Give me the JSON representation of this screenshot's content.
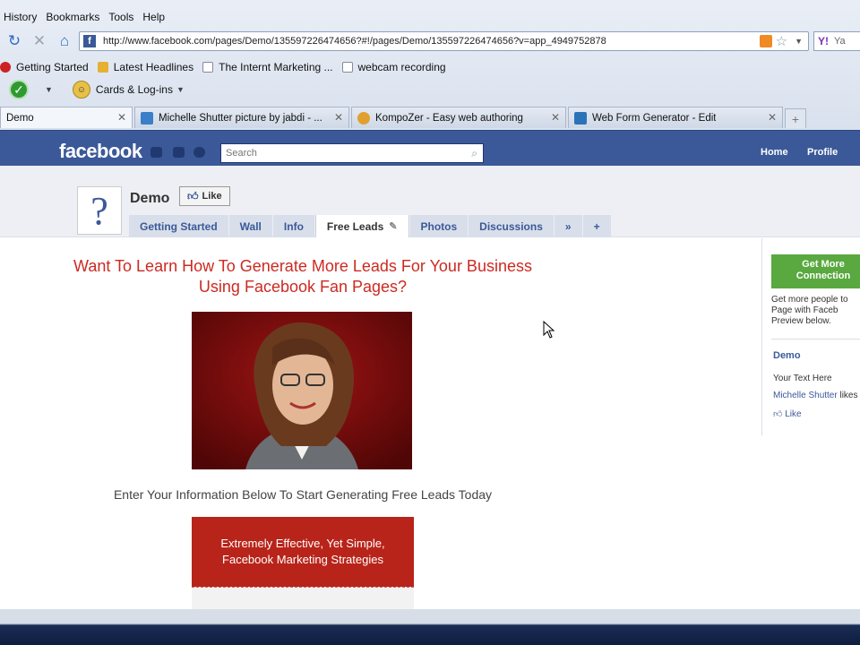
{
  "browser": {
    "menu": [
      "History",
      "Bookmarks",
      "Tools",
      "Help"
    ],
    "url": "http://www.facebook.com/pages/Demo/135597226474656?#!/pages/Demo/135597226474656?v=app_4949752878",
    "search_engine_label": "Ya",
    "bookmarks": [
      "Getting Started",
      "Latest Headlines",
      "The Internt Marketing ...",
      "webcam recording"
    ],
    "toolbar2_label": "Cards & Log-ins",
    "tabs": [
      {
        "label": "Demo",
        "active": true
      },
      {
        "label": "Michelle Shutter picture by jabdi - ...",
        "active": false
      },
      {
        "label": "KompoZer - Easy web authoring",
        "active": false
      },
      {
        "label": "Web Form Generator - Edit",
        "active": false
      }
    ]
  },
  "facebook": {
    "logo": "facebook",
    "search_placeholder": "Search",
    "nav": [
      "Home",
      "Profile"
    ],
    "page_name": "Demo",
    "like_label": "Like",
    "tabs": [
      "Getting Started",
      "Wall",
      "Info",
      "Free Leads",
      "Photos",
      "Discussions"
    ],
    "more_tabs": "»",
    "add_tab": "+",
    "headline": "Want To Learn How To Generate More Leads For Your Business Using Facebook Fan Pages?",
    "subtext": "Enter Your Information Below To Start Generating Free Leads Today",
    "promo_line1": "Extremely Effective, Yet Simple,",
    "promo_line2": "Facebook Marketing Strategies",
    "sidebar": {
      "connect_line1": "Get More",
      "connect_line2": "Connection",
      "description": "Get more people to Page with Faceb Preview below.",
      "page_name": "Demo",
      "your_text": "Your Text Here",
      "likes_user": "Michelle Shutter",
      "likes_suffix": "likes",
      "like_label": "Like"
    }
  },
  "colors": {
    "facebook_blue": "#3b5998",
    "headline_red": "#cc2a22",
    "promo_red": "#b8241a",
    "connect_green": "#5aa840"
  },
  "icons": [
    "reload-icon",
    "stop-icon",
    "home-icon",
    "rss-icon",
    "star-icon",
    "check-icon",
    "question-mark-icon",
    "thumbs-up-icon",
    "pencil-icon",
    "mouse-cursor-icon"
  ]
}
